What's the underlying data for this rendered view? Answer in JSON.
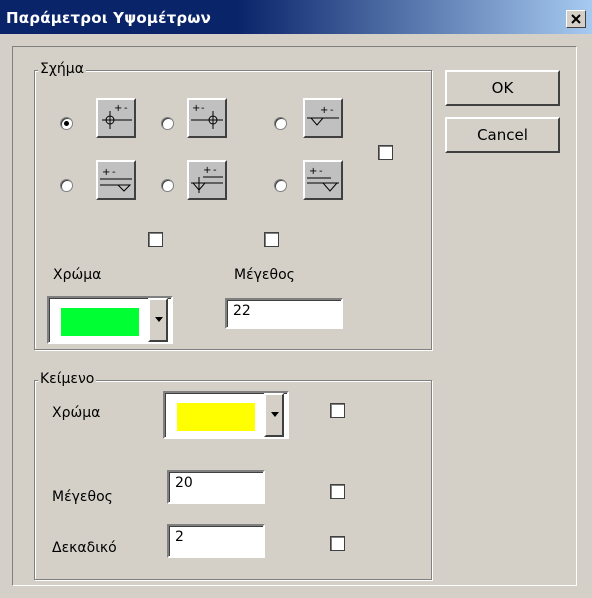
{
  "window": {
    "title": "Παράμετροι Υψομέτρων",
    "close_glyph": "✕"
  },
  "shape_group": {
    "legend": "Σχήμα",
    "selected_shape": 1,
    "color_label": "Χρώμα",
    "size_label": "Μέγεθος",
    "size_value": "22",
    "color_value": "#00ff33"
  },
  "text_group": {
    "legend": "Κείμενο",
    "color_label": "Χρώμα",
    "color_value": "#ffff00",
    "size_label": "Μέγεθος",
    "size_value": "20",
    "decimal_label": "Δεκαδικό",
    "decimal_value": "2"
  },
  "buttons": {
    "ok": "OK",
    "cancel": "Cancel"
  }
}
